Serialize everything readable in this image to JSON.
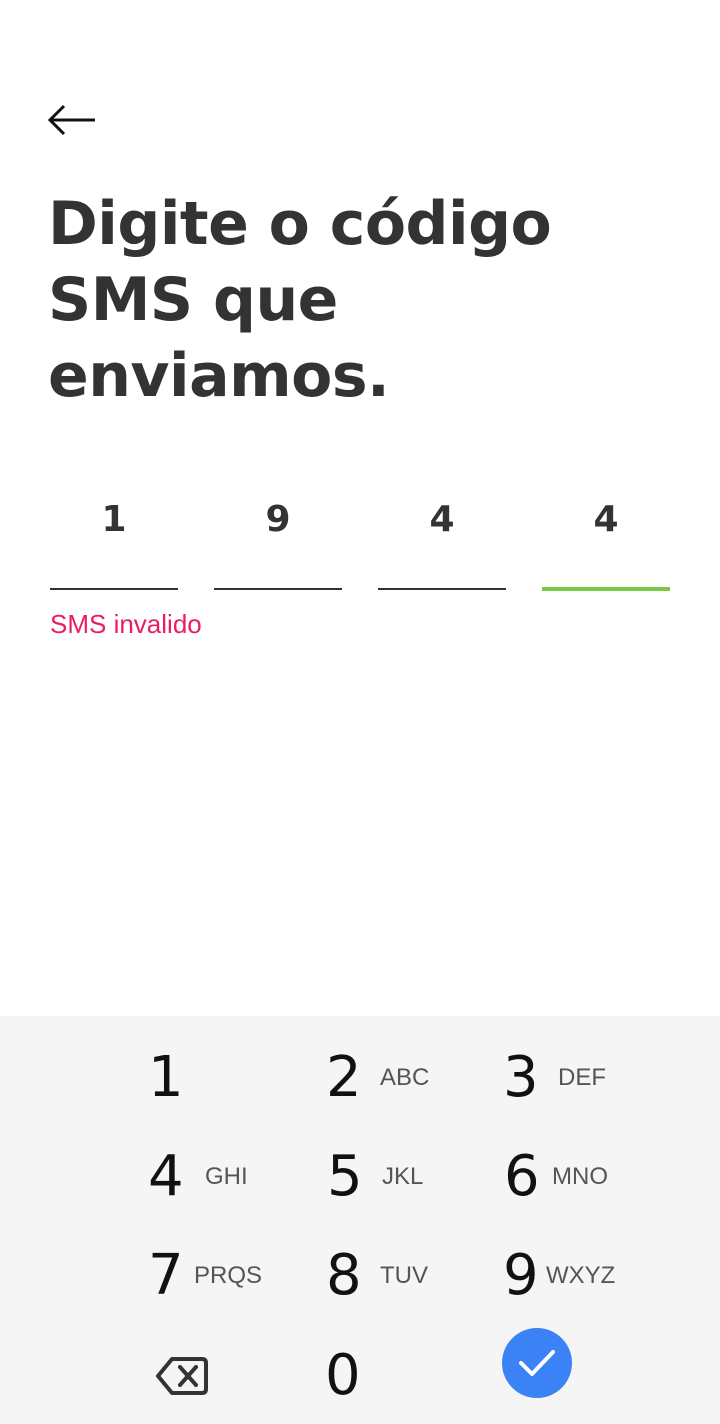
{
  "header": {
    "back_icon": "arrow-left-icon",
    "title": "Digite o código SMS que enviamos."
  },
  "code": {
    "digits": [
      "1",
      "9",
      "4",
      "4"
    ],
    "active_index": 3,
    "active_color": "#7ac943"
  },
  "error": {
    "text": "SMS invalido",
    "color": "#e91e63"
  },
  "keypad": {
    "background": "#f5f5f5",
    "keys": [
      {
        "digit": "1",
        "letters": ""
      },
      {
        "digit": "2",
        "letters": "ABC"
      },
      {
        "digit": "3",
        "letters": "DEF"
      },
      {
        "digit": "4",
        "letters": "GHI"
      },
      {
        "digit": "5",
        "letters": "JKL"
      },
      {
        "digit": "6",
        "letters": "MNO"
      },
      {
        "digit": "7",
        "letters": "PRQS"
      },
      {
        "digit": "8",
        "letters": "TUV"
      },
      {
        "digit": "9",
        "letters": "WXYZ"
      },
      {
        "digit": "0",
        "letters": ""
      }
    ],
    "backspace_icon": "backspace-icon",
    "submit_icon": "checkmark-icon",
    "submit_color": "#3b82f6"
  }
}
